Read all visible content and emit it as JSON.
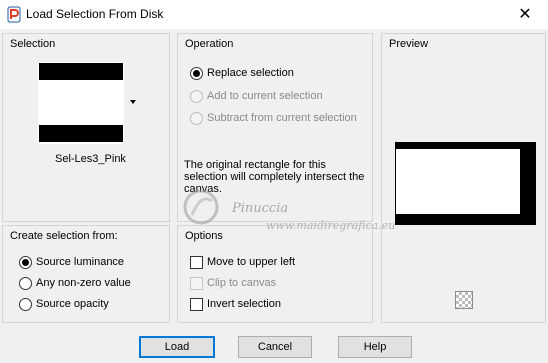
{
  "window": {
    "title": "Load Selection From Disk",
    "close_glyph": "✕"
  },
  "selection": {
    "group_title": "Selection",
    "file_name": "Sel-Les3_Pink"
  },
  "operation": {
    "group_title": "Operation",
    "options": [
      {
        "label": "Replace selection",
        "selected": true,
        "enabled": true
      },
      {
        "label": "Add to current selection",
        "selected": false,
        "enabled": false
      },
      {
        "label": "Subtract from current selection",
        "selected": false,
        "enabled": false
      }
    ],
    "description": "The original rectangle for this selection will completely intersect the canvas."
  },
  "preview": {
    "group_title": "Preview"
  },
  "create_from": {
    "group_title": "Create selection from:",
    "options": [
      {
        "label": "Source luminance",
        "selected": true
      },
      {
        "label": "Any non-zero value",
        "selected": false
      },
      {
        "label": "Source opacity",
        "selected": false
      }
    ]
  },
  "options": {
    "group_title": "Options",
    "checks": [
      {
        "label": "Move to upper left",
        "checked": false,
        "enabled": true
      },
      {
        "label": "Clip to canvas",
        "checked": false,
        "enabled": false
      },
      {
        "label": "Invert selection",
        "checked": false,
        "enabled": true
      }
    ]
  },
  "buttons": {
    "load": "Load",
    "cancel": "Cancel",
    "help": "Help"
  },
  "watermark": {
    "name": "Pinuccia",
    "site": "www.maidiregrafica.eu"
  },
  "icons": {
    "app": "psp-app-icon",
    "transparency": "checkerboard-icon",
    "dropdown": "dropdown-arrow-icon"
  }
}
